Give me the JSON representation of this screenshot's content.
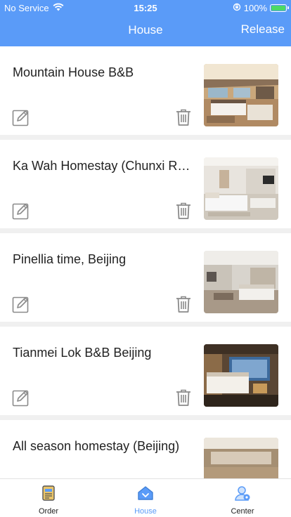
{
  "status_bar": {
    "carrier": "No Service",
    "time": "15:25",
    "battery": "100%"
  },
  "nav": {
    "title": "House",
    "action": "Release"
  },
  "houses": [
    {
      "title": "Mountain House B&B"
    },
    {
      "title": "Ka Wah Homestay (Chunxi Road)"
    },
    {
      "title": "Pinellia time, Beijing"
    },
    {
      "title": "Tianmei Lok B&B Beijing"
    },
    {
      "title": "All season homestay (Beijing)"
    }
  ],
  "tabbar": {
    "order_label": "Order",
    "house_label": "House",
    "center_label": "Center"
  },
  "colors": {
    "accent": "#5a9bf8",
    "battery": "#4cd964"
  }
}
